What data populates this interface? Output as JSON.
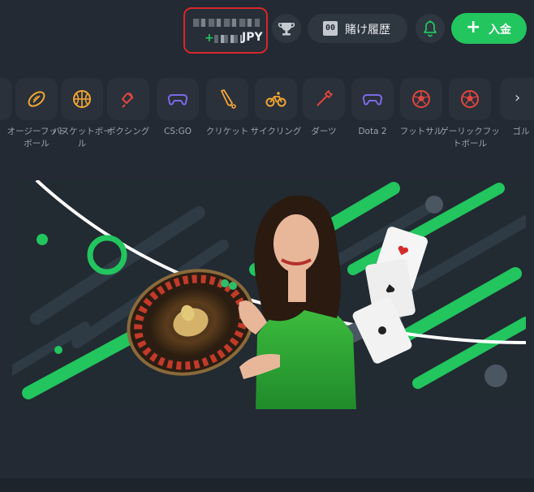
{
  "header": {
    "balance_currency": "JPY",
    "balance_plus": "+",
    "history_icon_digits": "00",
    "history_label": "賭け履歴",
    "deposit_plus": "+",
    "deposit_label": "入金"
  },
  "colors": {
    "background": "#232a33",
    "accent_green": "#22c55e",
    "highlight_red": "#d7262c",
    "icon_orange": "#f3a534",
    "icon_red": "#e2463f",
    "icon_purple": "#7a6ae6"
  },
  "sports": [
    {
      "label": "オージーフットボール",
      "icon": "rugby-ball-icon"
    },
    {
      "label": "バスケットボール",
      "icon": "basketball-icon"
    },
    {
      "label": "ボクシング",
      "icon": "boxing-glove-icon"
    },
    {
      "label": "CS:GO",
      "icon": "gamepad-icon"
    },
    {
      "label": "クリケット",
      "icon": "cricket-bat-icon"
    },
    {
      "label": "サイクリング",
      "icon": "bicycle-icon"
    },
    {
      "label": "ダーツ",
      "icon": "dart-icon"
    },
    {
      "label": "Dota 2",
      "icon": "gamepad-icon"
    },
    {
      "label": "フットサル",
      "icon": "soccer-ball-icon"
    },
    {
      "label": "ゲーリックフットボール",
      "icon": "soccer-ball-icon"
    },
    {
      "label": "ゴル",
      "icon": "golf-icon"
    }
  ],
  "sports_next_icon": "chevron-right-icon"
}
